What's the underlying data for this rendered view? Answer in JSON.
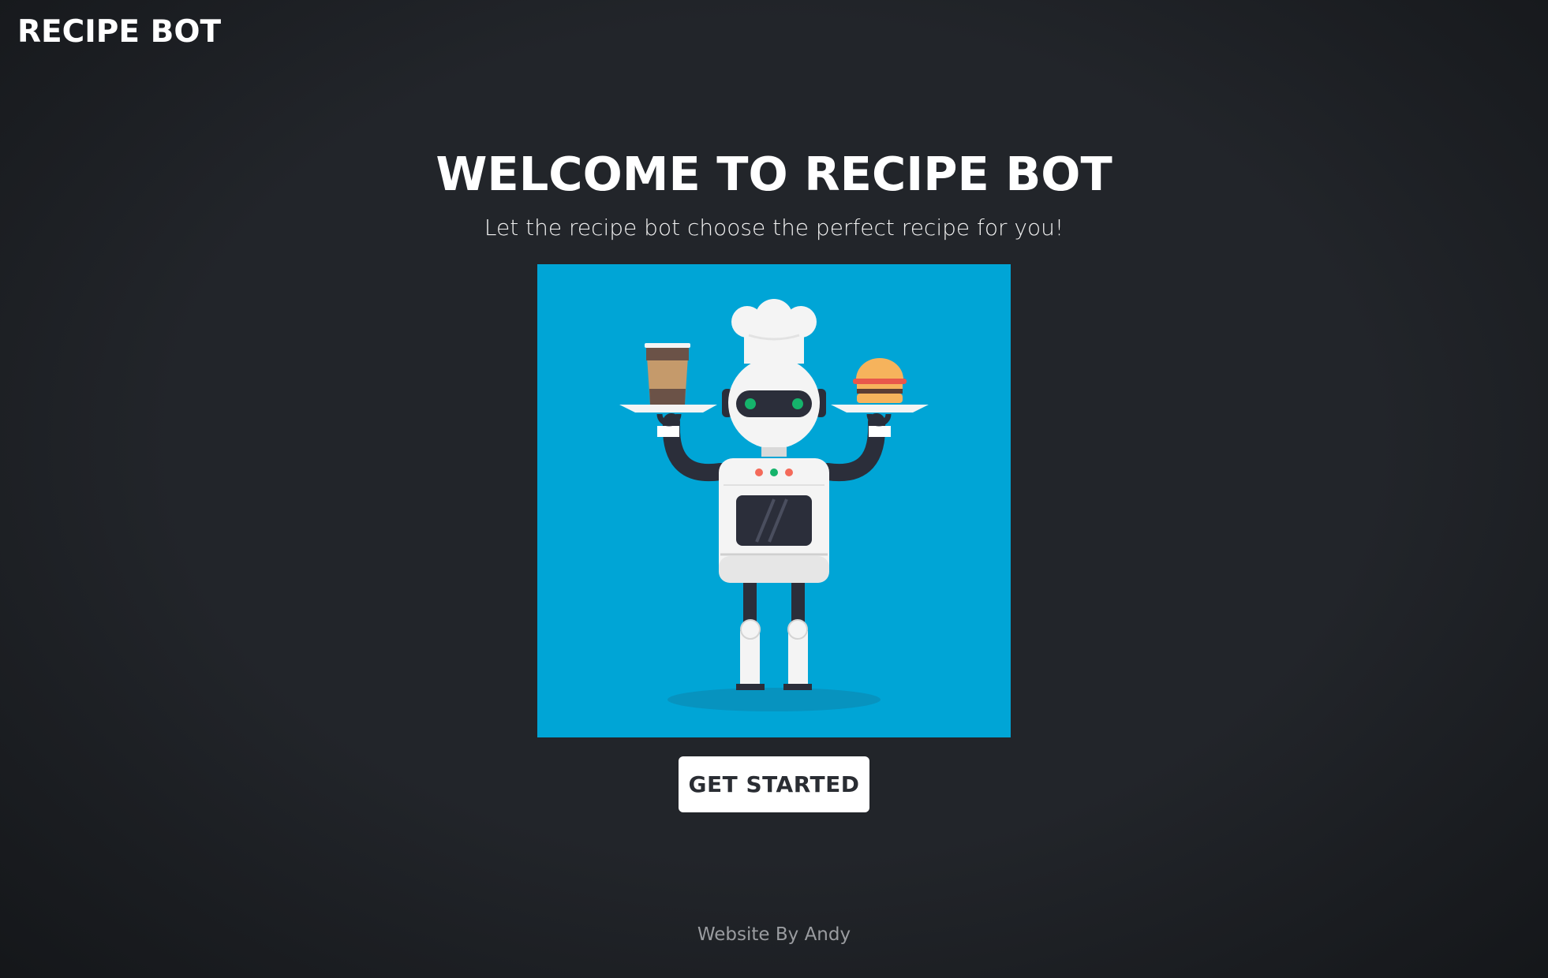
{
  "header": {
    "brand": "RECIPE BOT"
  },
  "hero": {
    "title": "WELCOME TO RECIPE BOT",
    "subtitle": "Let the recipe bot choose the perfect recipe for you!",
    "illustration_icon": "chef-robot-illustration",
    "illustration_bg": "#00a5d6"
  },
  "cta": {
    "label": "GET STARTED"
  },
  "footer": {
    "credit": "Website By Andy"
  },
  "colors": {
    "background": "#22252a",
    "button_bg": "#ffffff",
    "button_text": "#2a2d33",
    "footer_text": "#9a9ca0"
  }
}
